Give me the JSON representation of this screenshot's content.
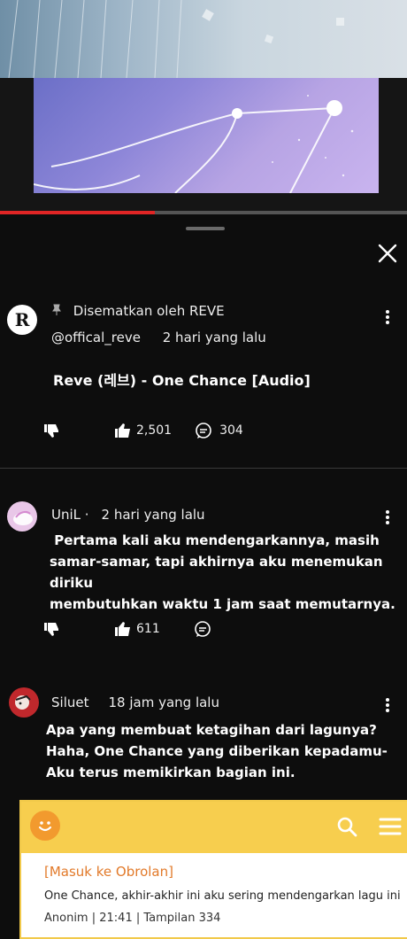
{
  "player": {
    "progress_fraction": 0.38
  },
  "comments": [
    {
      "avatar_letter": "R",
      "pinned_label": "Disematkan oleh REVE",
      "author": "@offical_reve",
      "time": "2 hari yang lalu",
      "text": "Reve (레브) - One Chance [Audio]",
      "likes": "2,501",
      "replies": "304"
    },
    {
      "author": "UniL ·",
      "time": "2 hari yang lalu",
      "text_lines": [
        " Pertama kali aku mendengarkannya, masih",
        "samar-samar, tapi akhirnya aku menemukan diriku",
        "membutuhkan waktu 1 jam saat memutarnya."
      ],
      "likes": "611"
    },
    {
      "author": "Siluet",
      "time": "18 jam yang lalu",
      "text_lines": [
        "Apa yang membuat ketagihan dari lagunya?",
        "Haha, One Chance yang diberikan kepadamu-",
        "Aku terus memikirkan bagian ini."
      ]
    }
  ],
  "chat": {
    "title": "[Masuk ke Obrolan]",
    "message": "One Chance, akhir-akhir ini aku sering mendengarkan lagu ini",
    "meta": "Anonim | 21:41 | Tampilan 334"
  },
  "colors": {
    "accent_red": "#e02525",
    "chat_yellow": "#f7ce4e",
    "chat_title": "#e27a2a"
  }
}
